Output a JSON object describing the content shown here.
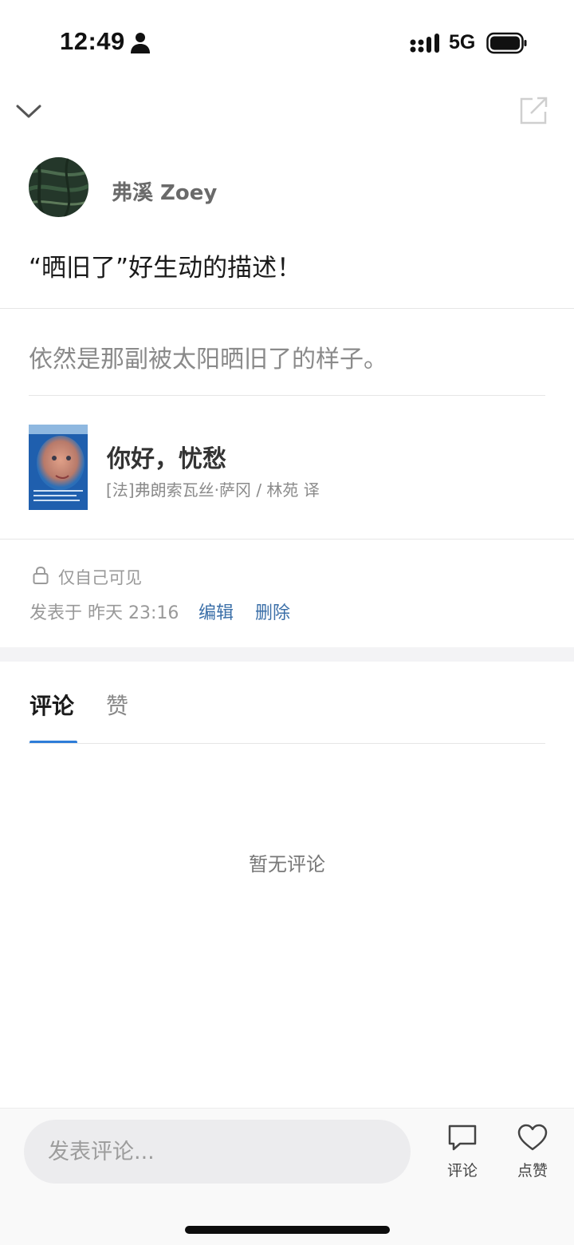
{
  "status_bar": {
    "time": "12:49",
    "network": "5G"
  },
  "header": {
    "back_icon": "chevron-down-icon",
    "share_icon": "share-icon"
  },
  "author": {
    "name": "弗溪 Zoey"
  },
  "note": {
    "text": "“晒旧了”好生动的描述！"
  },
  "quote": {
    "text": "依然是那副被太阳晒旧了的样子。"
  },
  "book": {
    "title": "你好，忧愁",
    "author_line": "[法]弗朗索瓦丝·萨冈 / 林苑 译"
  },
  "meta": {
    "visibility": "仅自己可见",
    "posted": "发表于 昨天 23:16",
    "edit_label": "编辑",
    "delete_label": "删除"
  },
  "tabs": {
    "comments": "评论",
    "likes": "赞",
    "active": "comments"
  },
  "comments": {
    "empty_text": "暂无评论"
  },
  "bottom_bar": {
    "input_placeholder": "发表评论...",
    "comment_label": "评论",
    "like_label": "点赞"
  },
  "colors": {
    "accent": "#2e7dd8",
    "link": "#3b6fa8",
    "muted": "#999999"
  }
}
